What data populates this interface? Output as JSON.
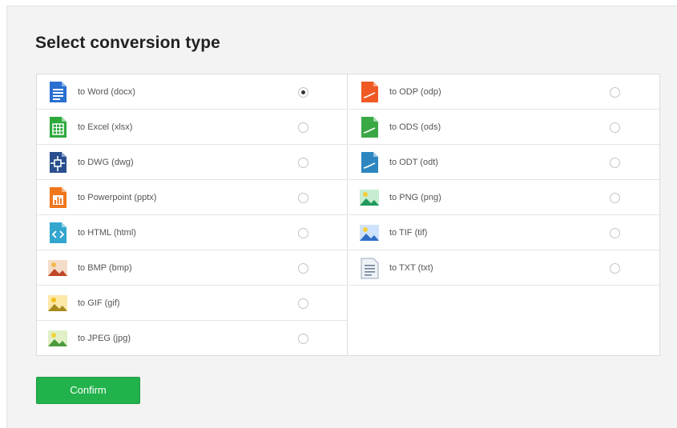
{
  "title": "Select conversion type",
  "left_options": [
    {
      "label": "to Word (docx)",
      "icon": "word-document-icon",
      "selected": true
    },
    {
      "label": "to Excel (xlsx)",
      "icon": "excel-spreadsheet-icon",
      "selected": false
    },
    {
      "label": "to DWG (dwg)",
      "icon": "dwg-cad-icon",
      "selected": false
    },
    {
      "label": "to Powerpoint (pptx)",
      "icon": "powerpoint-presentation-icon",
      "selected": false
    },
    {
      "label": "to HTML (html)",
      "icon": "html-code-icon",
      "selected": false
    },
    {
      "label": "to BMP (bmp)",
      "icon": "bmp-image-icon",
      "selected": false
    },
    {
      "label": "to GIF (gif)",
      "icon": "gif-image-icon",
      "selected": false
    },
    {
      "label": "to JPEG (jpg)",
      "icon": "jpeg-image-icon",
      "selected": false
    }
  ],
  "right_options": [
    {
      "label": "to ODP (odp)",
      "icon": "odp-presentation-icon",
      "selected": false
    },
    {
      "label": "to ODS (ods)",
      "icon": "ods-spreadsheet-icon",
      "selected": false
    },
    {
      "label": "to ODT (odt)",
      "icon": "odt-document-icon",
      "selected": false
    },
    {
      "label": "to PNG (png)",
      "icon": "png-image-icon",
      "selected": false
    },
    {
      "label": "to TIF (tif)",
      "icon": "tif-image-icon",
      "selected": false
    },
    {
      "label": "to TXT (txt)",
      "icon": "txt-text-icon",
      "selected": false
    }
  ],
  "confirm_label": "Confirm",
  "colors": {
    "word": "#2b6fd1",
    "excel": "#2eaa3c",
    "dwg": "#2a4f8f",
    "powerpoint": "#f0761c",
    "html": "#33a6cf",
    "odp": "#ef5a24",
    "ods": "#3ba846",
    "odt": "#2e86c1",
    "confirm": "#22b24c"
  }
}
